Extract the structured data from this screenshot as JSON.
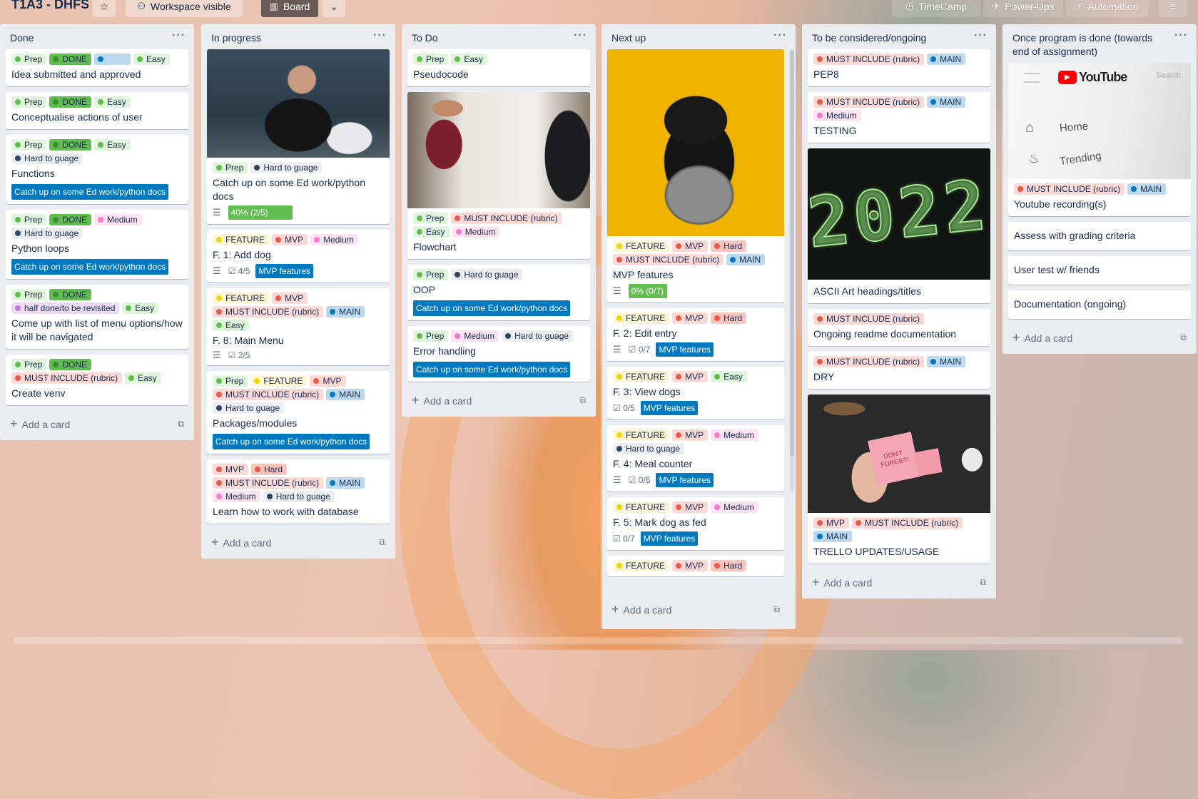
{
  "header": {
    "title": "T1A3 - DHFS",
    "visibility": "Workspace visible",
    "view": "Board",
    "timecamp": "TimeCamp",
    "powerups": "Power-Ups",
    "automation": "Automation"
  },
  "add_card_label": "Add a card",
  "lists": {
    "done": {
      "title": "Done",
      "cards": [
        {
          "title": "Idea submitted and approved"
        },
        {
          "title": "Conceptualise actions of user"
        },
        {
          "title": "Functions",
          "link": "Catch up on some Ed work/python docs"
        },
        {
          "title": "Python loops",
          "link": "Catch up on some Ed work/python docs"
        },
        {
          "title": "Come up with list of menu options/how it will be navigated"
        },
        {
          "title": "Create venv"
        }
      ]
    },
    "progress": {
      "title": "In progress",
      "cards": [
        {
          "title": "Catch up on some Ed work/python docs",
          "progress": "40% (2/5)"
        },
        {
          "title": "F. 1: Add dog",
          "checklist": "4/5",
          "tag": "MVP features"
        },
        {
          "title": "F. 8: Main Menu",
          "checklist": "2/5"
        },
        {
          "title": "Packages/modules",
          "link": "Catch up on some Ed work/python docs"
        },
        {
          "title": "Learn how to work with database"
        }
      ]
    },
    "todo": {
      "title": "To Do",
      "cards": [
        {
          "title": "Pseudocode"
        },
        {
          "title": "Flowchart"
        },
        {
          "title": "OOP",
          "link": "Catch up on some Ed work/python docs"
        },
        {
          "title": "Error handling",
          "link": "Catch up on some Ed work/python docs"
        }
      ]
    },
    "next": {
      "title": "Next up",
      "cards": [
        {
          "title": "MVP features",
          "progress": "0% (0/7)"
        },
        {
          "title": "F. 2: Edit entry",
          "checklist": "0/7",
          "tag": "MVP features"
        },
        {
          "title": "F. 3: View dogs",
          "checklist": "0/5",
          "tag": "MVP features"
        },
        {
          "title": "F. 4: Meal counter",
          "checklist": "0/6",
          "tag": "MVP features"
        },
        {
          "title": "F. 5: Mark dog as fed",
          "checklist": "0/7",
          "tag": "MVP features"
        }
      ]
    },
    "consider": {
      "title": "To be considered/ongoing",
      "cards": [
        {
          "title": "PEP8"
        },
        {
          "title": "TESTING"
        },
        {
          "title": "ASCII Art headings/titles"
        },
        {
          "title": "Ongoing readme documentation"
        },
        {
          "title": "DRY"
        },
        {
          "title": "TRELLO UPDATES/USAGE"
        }
      ]
    },
    "once": {
      "title": "Once program is done (towards end of assignment)",
      "cards": [
        {
          "title": "Youtube recording(s)",
          "cover_brand": "YouTube",
          "cover_home": "Home",
          "cover_trending": "Trending",
          "cover_search": "Search"
        },
        {
          "title": "Assess with grading criteria"
        },
        {
          "title": "User test w/ friends"
        },
        {
          "title": "Documentation (ongoing)"
        }
      ]
    }
  },
  "labels": {
    "prep": "Prep",
    "done": "DONE",
    "easy": "Easy",
    "medium": "Medium",
    "hard": "Hard",
    "hard_to_guage": "Hard to guage",
    "half_done": "half done/to be revisited",
    "must_include": "MUST INCLUDE (rubric)",
    "main": "MAIN",
    "feature": "FEATURE",
    "mvp": "MVP"
  },
  "covers": {
    "sticky_note": "DON'T FORGET!",
    "year": "2022"
  },
  "colors": {
    "green": "#61bd4f",
    "blue": "#0079bf",
    "red": "#eb5a46",
    "yellow": "#f2d600",
    "pink": "#ff78cb",
    "purple": "#c377e0",
    "dark": "#344563"
  }
}
